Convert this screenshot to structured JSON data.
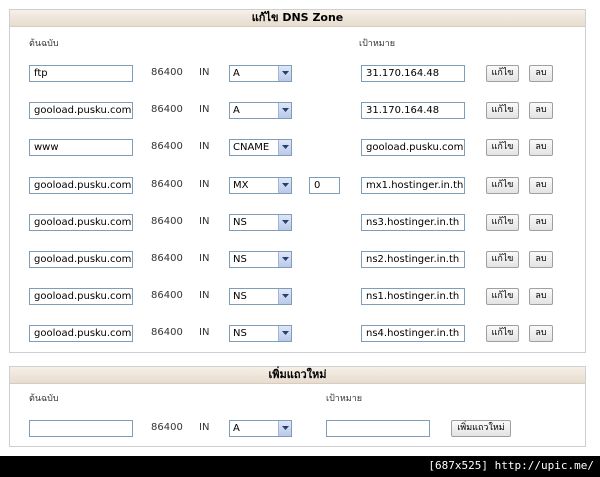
{
  "edit_panel": {
    "title": "แก้ไข DNS Zone",
    "source_label": "ต้นฉบับ",
    "target_label": "เป้าหมาย",
    "rows": [
      {
        "source": "ftp",
        "ttl": "86400",
        "cls": "IN",
        "type": "A",
        "priority": "",
        "target": "31.170.164.48",
        "edit": "แก้ไข",
        "delete": "ลบ"
      },
      {
        "source": "gooload.pusku.com",
        "ttl": "86400",
        "cls": "IN",
        "type": "A",
        "priority": "",
        "target": "31.170.164.48",
        "edit": "แก้ไข",
        "delete": "ลบ"
      },
      {
        "source": "www",
        "ttl": "86400",
        "cls": "IN",
        "type": "CNAME",
        "priority": "",
        "target": "gooload.pusku.com",
        "edit": "แก้ไข",
        "delete": "ลบ"
      },
      {
        "source": "gooload.pusku.com",
        "ttl": "86400",
        "cls": "IN",
        "type": "MX",
        "priority": "0",
        "target": "mx1.hostinger.in.th",
        "edit": "แก้ไข",
        "delete": "ลบ"
      },
      {
        "source": "gooload.pusku.com",
        "ttl": "86400",
        "cls": "IN",
        "type": "NS",
        "priority": "",
        "target": "ns3.hostinger.in.th",
        "edit": "แก้ไข",
        "delete": "ลบ"
      },
      {
        "source": "gooload.pusku.com",
        "ttl": "86400",
        "cls": "IN",
        "type": "NS",
        "priority": "",
        "target": "ns2.hostinger.in.th",
        "edit": "แก้ไข",
        "delete": "ลบ"
      },
      {
        "source": "gooload.pusku.com",
        "ttl": "86400",
        "cls": "IN",
        "type": "NS",
        "priority": "",
        "target": "ns1.hostinger.in.th",
        "edit": "แก้ไข",
        "delete": "ลบ"
      },
      {
        "source": "gooload.pusku.com",
        "ttl": "86400",
        "cls": "IN",
        "type": "NS",
        "priority": "",
        "target": "ns4.hostinger.in.th",
        "edit": "แก้ไข",
        "delete": "ลบ"
      }
    ]
  },
  "add_panel": {
    "title": "เพิ่มแถวใหม่",
    "source_label": "ต้นฉบับ",
    "target_label": "เป้าหมาย",
    "source_value": "",
    "ttl": "86400",
    "cls": "IN",
    "type": "A",
    "target_value": "",
    "add_button": "เพิ่มแถวใหม่"
  },
  "footer": {
    "text": "[687x525] http://upic.me/"
  },
  "colors": {
    "header_bg": "#e7dccf",
    "input_border": "#7f9db9"
  },
  "icons": {
    "dropdown_arrow": "chevron-down-icon"
  }
}
